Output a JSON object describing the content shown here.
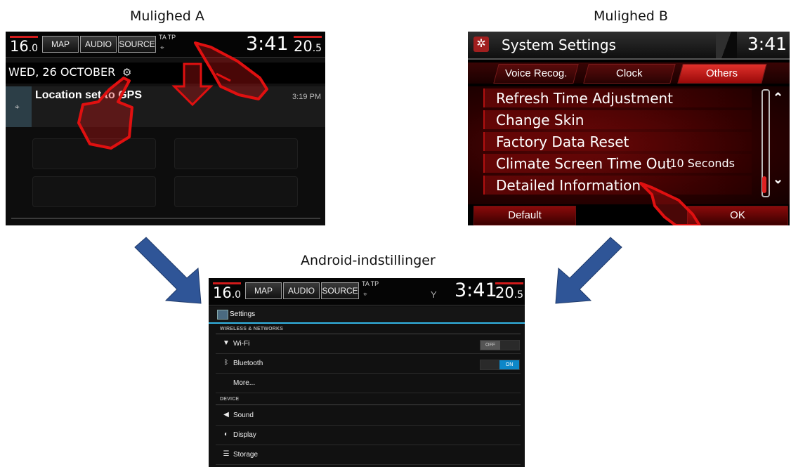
{
  "captions": {
    "a": "Mulighed A",
    "b": "Mulighed B",
    "c": "Android-indstillinger"
  },
  "status_bar": {
    "temp_left_int": "16",
    "temp_left_dec": ".0",
    "temp_right_int": "20",
    "temp_right_dec": ".5",
    "map_label": "MAP",
    "audio_label": "AUDIO",
    "source_label": "SOURCE",
    "ta_tp": "TA TP",
    "clock": "3:41"
  },
  "panel_a": {
    "date": "WED, 26 OCTOBER",
    "notification_title": "Location set to GPS",
    "notification_time": "3:19 PM"
  },
  "panel_b": {
    "title": "System Settings",
    "clock": "3:41",
    "tabs": [
      "Voice Recog.",
      "Clock",
      "Others"
    ],
    "active_tab": "Others",
    "items": [
      {
        "label": "Refresh Time Adjustment",
        "value": ""
      },
      {
        "label": "Change Skin",
        "value": ""
      },
      {
        "label": "Factory Data Reset",
        "value": ""
      },
      {
        "label": "Climate Screen Time Out",
        "value": "10 Seconds"
      },
      {
        "label": "Detailed Information",
        "value": ""
      }
    ],
    "default_label": "Default",
    "ok_label": "OK"
  },
  "panel_c": {
    "header": "Settings",
    "section_wireless": "WIRELESS & NETWORKS",
    "wifi_label": "Wi-Fi",
    "wifi_state": "OFF",
    "bluetooth_label": "Bluetooth",
    "bluetooth_state": "ON",
    "more_label": "More...",
    "section_device": "DEVICE",
    "sound_label": "Sound",
    "display_label": "Display",
    "storage_label": "Storage"
  },
  "colors": {
    "accent_blue": "#33b5e5",
    "arrow_blue": "#2f5597",
    "honda_red": "#c0100f"
  }
}
